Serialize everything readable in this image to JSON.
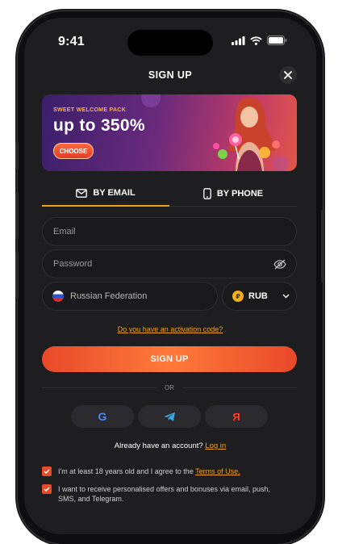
{
  "status": {
    "time": "9:41"
  },
  "page": {
    "title": "SIGN UP"
  },
  "banner": {
    "pack_label": "SWEET WELCOME PACK",
    "amount": "up to 350%",
    "button": "CHOOSE"
  },
  "tabs": [
    {
      "label": "BY EMAIL",
      "icon": "envelope-icon",
      "active": true
    },
    {
      "label": "BY PHONE",
      "icon": "phone-icon",
      "active": false
    }
  ],
  "form": {
    "email_placeholder": "Email",
    "password_placeholder": "Password",
    "country": "Russian Federation",
    "currency": "RUB",
    "currency_symbol": "₽"
  },
  "activation_link": "Do you have an activation code?",
  "signup_button": "SIGN UP",
  "divider": "OR",
  "social": [
    {
      "name": "google-icon",
      "glyph": "G"
    },
    {
      "name": "telegram-icon",
      "glyph": ""
    },
    {
      "name": "yandex-icon",
      "glyph": "Я"
    }
  ],
  "login": {
    "prompt": "Already have an account?",
    "link": "Log in"
  },
  "consents": [
    {
      "text": "I'm at least 18 years old and I agree to the ",
      "link": "Terms of Use.",
      "checked": true
    },
    {
      "text": "I want to receive personalised offers and bonuses via email, push, SMS, and Telegram.",
      "link": "",
      "checked": true
    }
  ],
  "colors": {
    "accent": "#f0a11a",
    "primary": "#e8492a",
    "background": "#1e1e20"
  }
}
